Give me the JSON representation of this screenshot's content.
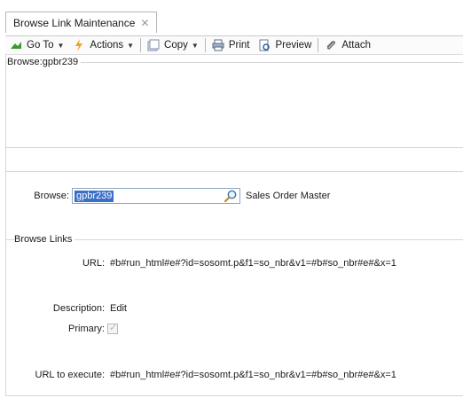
{
  "tab": {
    "title": "Browse Link Maintenance",
    "close_glyph": "✕"
  },
  "toolbar": {
    "goto_label": "Go To",
    "actions_label": "Actions",
    "copy_label": "Copy",
    "print_label": "Print",
    "preview_label": "Preview",
    "attach_label": "Attach"
  },
  "top_section": {
    "legend": "Browse:gpbr239"
  },
  "browse_field": {
    "label": "Browse:",
    "value": "gpbr239",
    "description": "Sales Order Master"
  },
  "browse_links": {
    "legend": "Browse Links",
    "url_label": "URL:",
    "url_value": "#b#run_html#e#?id=sosomt.p&f1=so_nbr&v1=#b#so_nbr#e#&x=1",
    "description_label": "Description:",
    "description_value": "Edit",
    "primary_label": "Primary:",
    "primary_checked": true,
    "url_execute_label": "URL to execute:",
    "url_execute_value": "#b#run_html#e#?id=sosomt.p&f1=so_nbr&v1=#b#so_nbr#e#&x=1"
  },
  "colors": {
    "selection": "#3b6fc6",
    "border": "#d6d6d6",
    "goto_icon": "#3a9a2a",
    "actions_icon": "#f0a020"
  },
  "icons": [
    "goto-icon",
    "actions-icon",
    "copy-icon",
    "print-icon",
    "preview-icon",
    "attach-icon",
    "search-icon"
  ]
}
